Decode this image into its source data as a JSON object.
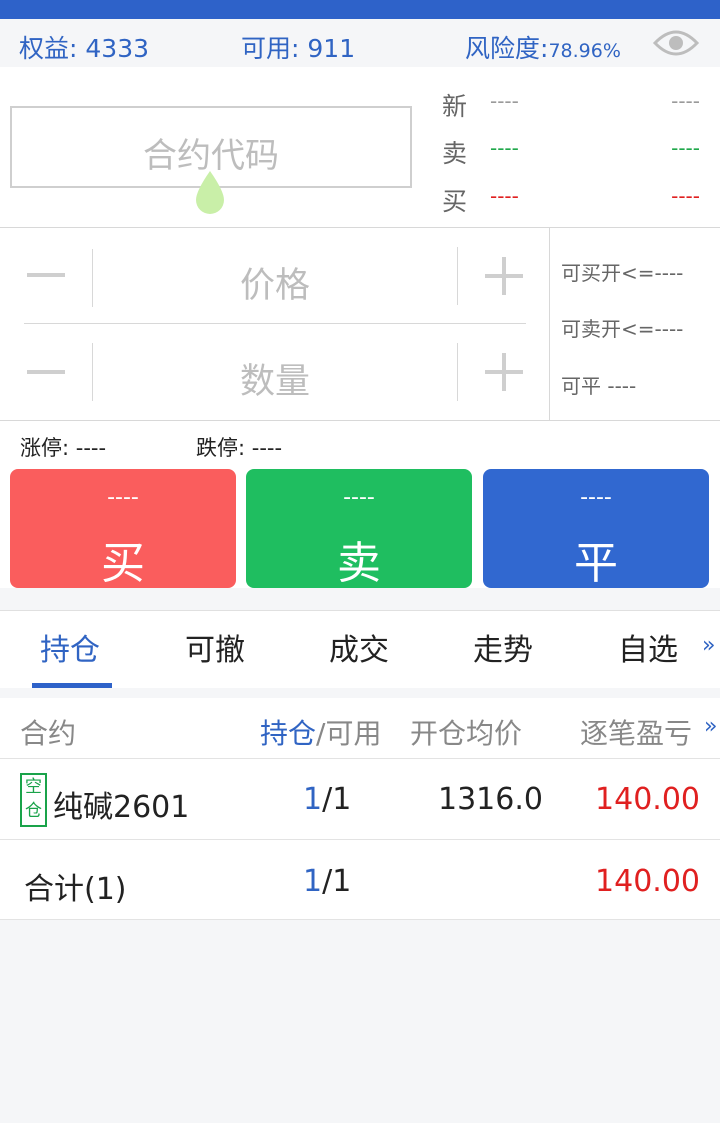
{
  "account": {
    "equity_label": "权益:",
    "equity_value": "4333",
    "available_label": "可用:",
    "available_value": "911",
    "risk_label": "风险度:",
    "risk_value": "78.96%",
    "visibility_icon": "eye-icon"
  },
  "order": {
    "code_placeholder": "合约代码",
    "quotes": [
      {
        "label": "新",
        "left": "----",
        "right": "----"
      },
      {
        "label": "卖",
        "left": "----",
        "right": "----"
      },
      {
        "label": "买",
        "left": "----",
        "right": "----"
      }
    ],
    "price_placeholder": "价格",
    "quantity_placeholder": "数量",
    "can_buy_open": "可买开<=----",
    "can_sell_open": "可卖开<=----",
    "can_close": "可平  ----",
    "limit_up": "涨停: ----",
    "limit_down": "跌停: ----",
    "buy_price": "----",
    "buy_label": "买",
    "sell_price": "----",
    "sell_label": "卖",
    "close_price": "----",
    "close_label": "平"
  },
  "colors": {
    "buy": "#fa5d5d",
    "sell": "#1fbe60",
    "close": "#3168d0",
    "accent": "#3064c3"
  },
  "tabs": [
    {
      "label": "持仓",
      "active": true
    },
    {
      "label": "可撤"
    },
    {
      "label": "成交"
    },
    {
      "label": "走势"
    },
    {
      "label": "自选"
    }
  ],
  "tabs_more": "»",
  "positions": {
    "headers": {
      "contract": "合约",
      "position_a": "持仓",
      "position_b": "/可用",
      "avg_price": "开仓均价",
      "pnl": "逐笔盈亏",
      "more": "»"
    },
    "rows": [
      {
        "badge_top": "空",
        "badge_bottom": "仓",
        "contract": "纯碱2601",
        "hold": "1",
        "avail": "/1",
        "avg_price": "1316.0",
        "pnl": "140.00"
      }
    ],
    "total": {
      "label": "合计(1)",
      "hold": "1",
      "avail": "/1",
      "pnl": "140.00"
    }
  }
}
